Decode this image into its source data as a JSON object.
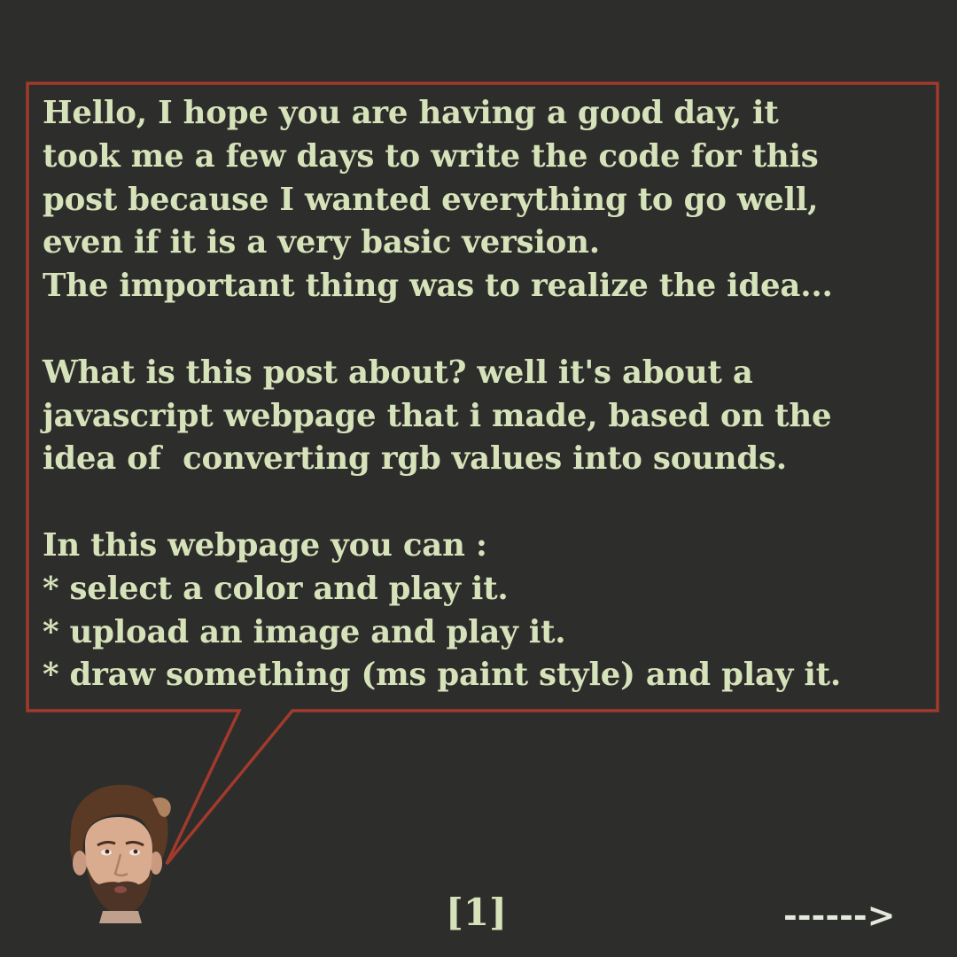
{
  "bubble": {
    "border_color": "#a23a2c",
    "lines": [
      "Hello, I hope you are having a good day, it",
      "took me a few days to write the code for this",
      "post because I wanted everything to go well,",
      "even if it is a very basic version.",
      "The important thing was to realize the idea...",
      "",
      "What is this post about? well it's about a",
      "javascript webpage that i made, based on the",
      "idea of  converting rgb values into sounds.",
      "",
      "In this webpage you can :",
      "* select a color and play it.",
      "* upload an image and play it.",
      "* draw something (ms paint style) and play it."
    ]
  },
  "avatar": {
    "icon": "person-face-icon"
  },
  "footer": {
    "page_number": "[1]",
    "next_arrow": "------>"
  },
  "colors": {
    "background": "#2d2d2b",
    "text": "#d6e2b9",
    "border": "#a23a2c"
  }
}
